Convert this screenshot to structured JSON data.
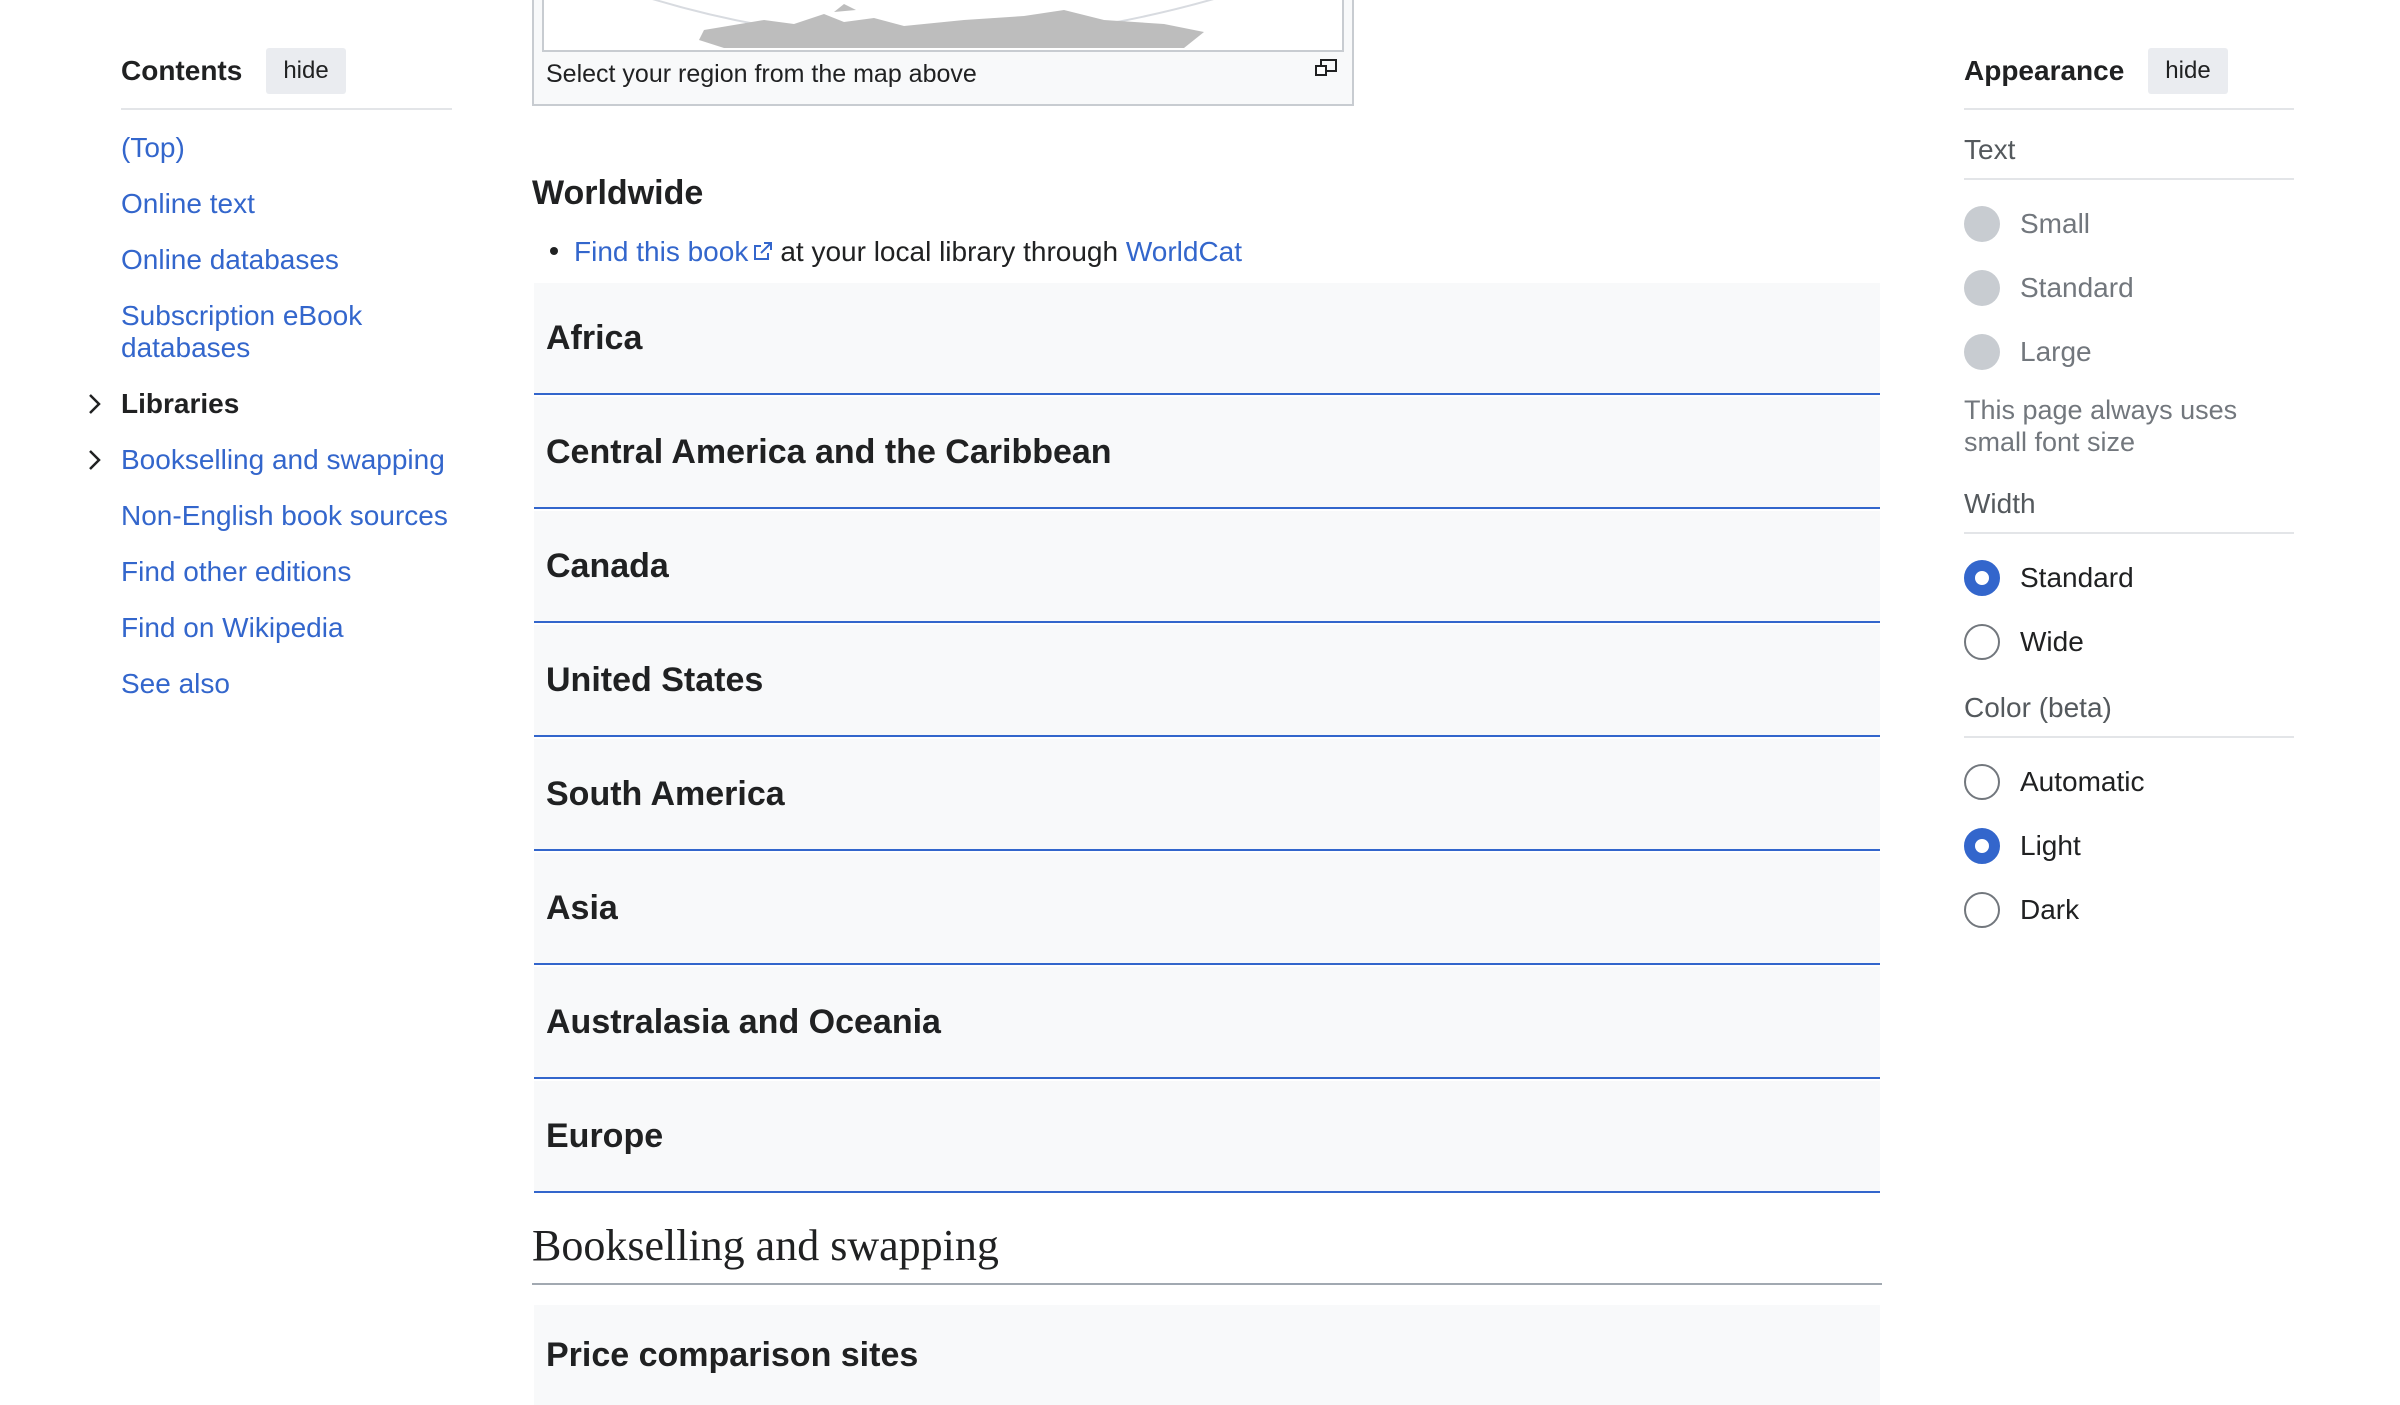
{
  "toc": {
    "title": "Contents",
    "hide_label": "hide",
    "items": [
      {
        "label": "(Top)"
      },
      {
        "label": "Online text"
      },
      {
        "label": "Online databases"
      },
      {
        "label": "Subscription eBook databases"
      },
      {
        "label": "Libraries",
        "expandable": true,
        "current": true
      },
      {
        "label": "Bookselling and swapping",
        "expandable": true
      },
      {
        "label": "Non-English book sources"
      },
      {
        "label": "Find other editions"
      },
      {
        "label": "Find on Wikipedia"
      },
      {
        "label": "See also"
      }
    ]
  },
  "main": {
    "map_caption": "Select your region from the map above",
    "worldwide_heading": "Worldwide",
    "worldwide_link": "Find this book",
    "worldwide_text": "at your local library through",
    "worldwide_link2": "WorldCat",
    "regions": [
      "Africa",
      "Central America and the Caribbean",
      "Canada",
      "United States",
      "South America",
      "Asia",
      "Australasia and Oceania",
      "Europe"
    ],
    "section_heading": "Bookselling and swapping",
    "price_heading": "Price comparison sites"
  },
  "appearance": {
    "title": "Appearance",
    "hide_label": "hide",
    "text_label": "Text",
    "text_options": [
      "Small",
      "Standard",
      "Large"
    ],
    "text_note": "This page always uses small font size",
    "width_label": "Width",
    "width_options": [
      "Standard",
      "Wide"
    ],
    "width_selected": "Standard",
    "color_label": "Color (beta)",
    "color_options": [
      "Automatic",
      "Light",
      "Dark"
    ],
    "color_selected": "Light"
  },
  "colors": {
    "link": "#3366cc",
    "accent": "#3366cc",
    "text": "#202122",
    "muted": "#72777d"
  }
}
